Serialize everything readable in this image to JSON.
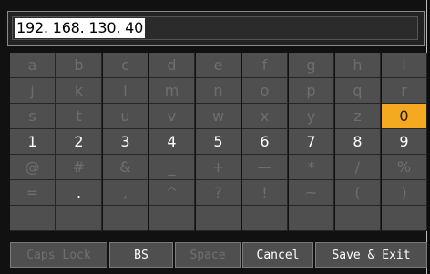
{
  "input": {
    "value": "192. 168. 130. 40"
  },
  "rows": [
    [
      "a",
      "b",
      "c",
      "d",
      "e",
      "f",
      "g",
      "h",
      "i"
    ],
    [
      "j",
      "k",
      "l",
      "m",
      "n",
      "o",
      "p",
      "q",
      "r"
    ],
    [
      "s",
      "t",
      "u",
      "v",
      "w",
      "x",
      "y",
      "z",
      "0"
    ],
    [
      "1",
      "2",
      "3",
      "4",
      "5",
      "6",
      "7",
      "8",
      "9"
    ],
    [
      "@",
      "#",
      "&",
      "_",
      "+",
      "—",
      "*",
      "/",
      "%"
    ],
    [
      "=",
      ".",
      ",",
      "^",
      "?",
      "!",
      "~",
      "(",
      ")"
    ]
  ],
  "enabled_keys": [
    "0",
    "1",
    "2",
    "3",
    "4",
    "5",
    "6",
    "7",
    "8",
    "9",
    "."
  ],
  "selected_key": "0",
  "buttons": {
    "caps_lock": "Caps Lock",
    "bs": "BS",
    "space": "Space",
    "cancel": "Cancel",
    "save_exit": "Save & Exit"
  },
  "colors": {
    "accent": "#f5a920",
    "key_bg": "#4f4f4f",
    "disabled_text": "#6e6e6e"
  }
}
